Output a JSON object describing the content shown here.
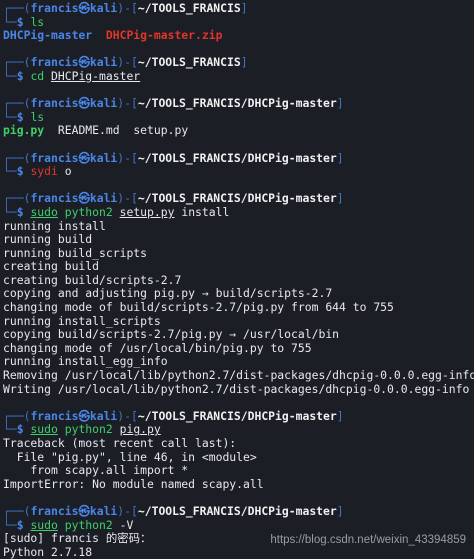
{
  "prompt": {
    "user": "francis",
    "at": "㉿",
    "host": "kali",
    "sign": "$"
  },
  "paths": {
    "tools": "~/TOOLS_FRANCIS",
    "dhcp": "~/TOOLS_FRANCIS/DHCPig-master"
  },
  "cmd1": {
    "text": "ls"
  },
  "ls1": {
    "dir": "DHCPig-master",
    "zip": "DHCPig-master.zip"
  },
  "cmd2": {
    "verb": "cd",
    "arg": "DHCPig-master"
  },
  "cmd3": {
    "text": "ls"
  },
  "ls2": {
    "exec": "pig.py",
    "f2": "README.md",
    "f3": "setup.py"
  },
  "cmd4": {
    "a": "sydi",
    "b": "o"
  },
  "cmd5": {
    "sudo": "sudo",
    "py": "python2",
    "arg": "setup.py",
    "rest": "install"
  },
  "install_output": [
    "running install",
    "running build",
    "running build_scripts",
    "creating build",
    "creating build/scripts-2.7",
    "copying and adjusting pig.py → build/scripts-2.7",
    "changing mode of build/scripts-2.7/pig.py from 644 to 755",
    "running install_scripts",
    "copying build/scripts-2.7/pig.py → /usr/local/bin",
    "changing mode of /usr/local/bin/pig.py to 755",
    "running install_egg_info",
    "Removing /usr/local/lib/python2.7/dist-packages/dhcpig-0.0.0.egg-info",
    "Writing /usr/local/lib/python2.7/dist-packages/dhcpig-0.0.0.egg-info"
  ],
  "cmd6": {
    "sudo": "sudo",
    "py": "python2",
    "arg": "pig.py"
  },
  "traceback": [
    "Traceback (most recent call last):",
    "  File \"pig.py\", line 46, in <module>",
    "    from scapy.all import *",
    "ImportError: No module named scapy.all"
  ],
  "cmd7": {
    "sudo": "sudo",
    "py": "python2",
    "arg": "-V"
  },
  "final_output": [
    "[sudo] francis 的密码：",
    "Python 2.7.18"
  ],
  "watermark": "https://blog.csdn.net/weixin_43394859"
}
